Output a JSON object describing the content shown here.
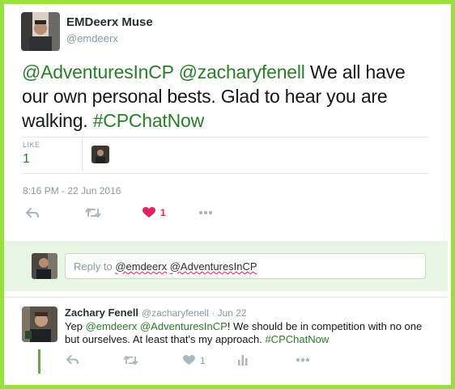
{
  "tweet": {
    "author_name": "EMDeerx Muse",
    "author_handle": "@emdeerx",
    "text_mention_1": "@AdventuresInCP",
    "text_mention_2": "@zacharyfenell",
    "text_body": " We all have our own personal bests. Glad to hear you are walking. ",
    "text_hashtag": "#CPChatNow",
    "like_label": "LIKE",
    "like_count": "1",
    "timestamp": "8:16 PM - 22 Jun 2016",
    "actions": {
      "reply_icon": "reply-icon",
      "retweet_icon": "retweet-icon",
      "like_icon": "heart-icon",
      "like_count": "1",
      "more_icon": "more-icon"
    }
  },
  "reply_composer": {
    "prefix": "Reply to ",
    "mention_1": "@emdeerx",
    "mention_2": "@AdventuresInCP"
  },
  "reply": {
    "author_name": "Zachary Fenell",
    "author_handle": "@zacharyfenell",
    "date": "Jun 22",
    "separator": " · ",
    "text_prefix": "Yep ",
    "mention_1": "@emdeerx",
    "mention_2": "@AdventuresInCP",
    "text_body": "! We should be in competition with no one but ourselves. At least that's my approach. ",
    "hashtag": "#CPChatNow",
    "like_count": "1"
  },
  "colors": {
    "frame_border": "#9ae03c",
    "link_green": "#2a7d2a",
    "like_red": "#e0245e",
    "reply_bg": "#e8f5e3",
    "thread_line": "#6aa84f"
  }
}
